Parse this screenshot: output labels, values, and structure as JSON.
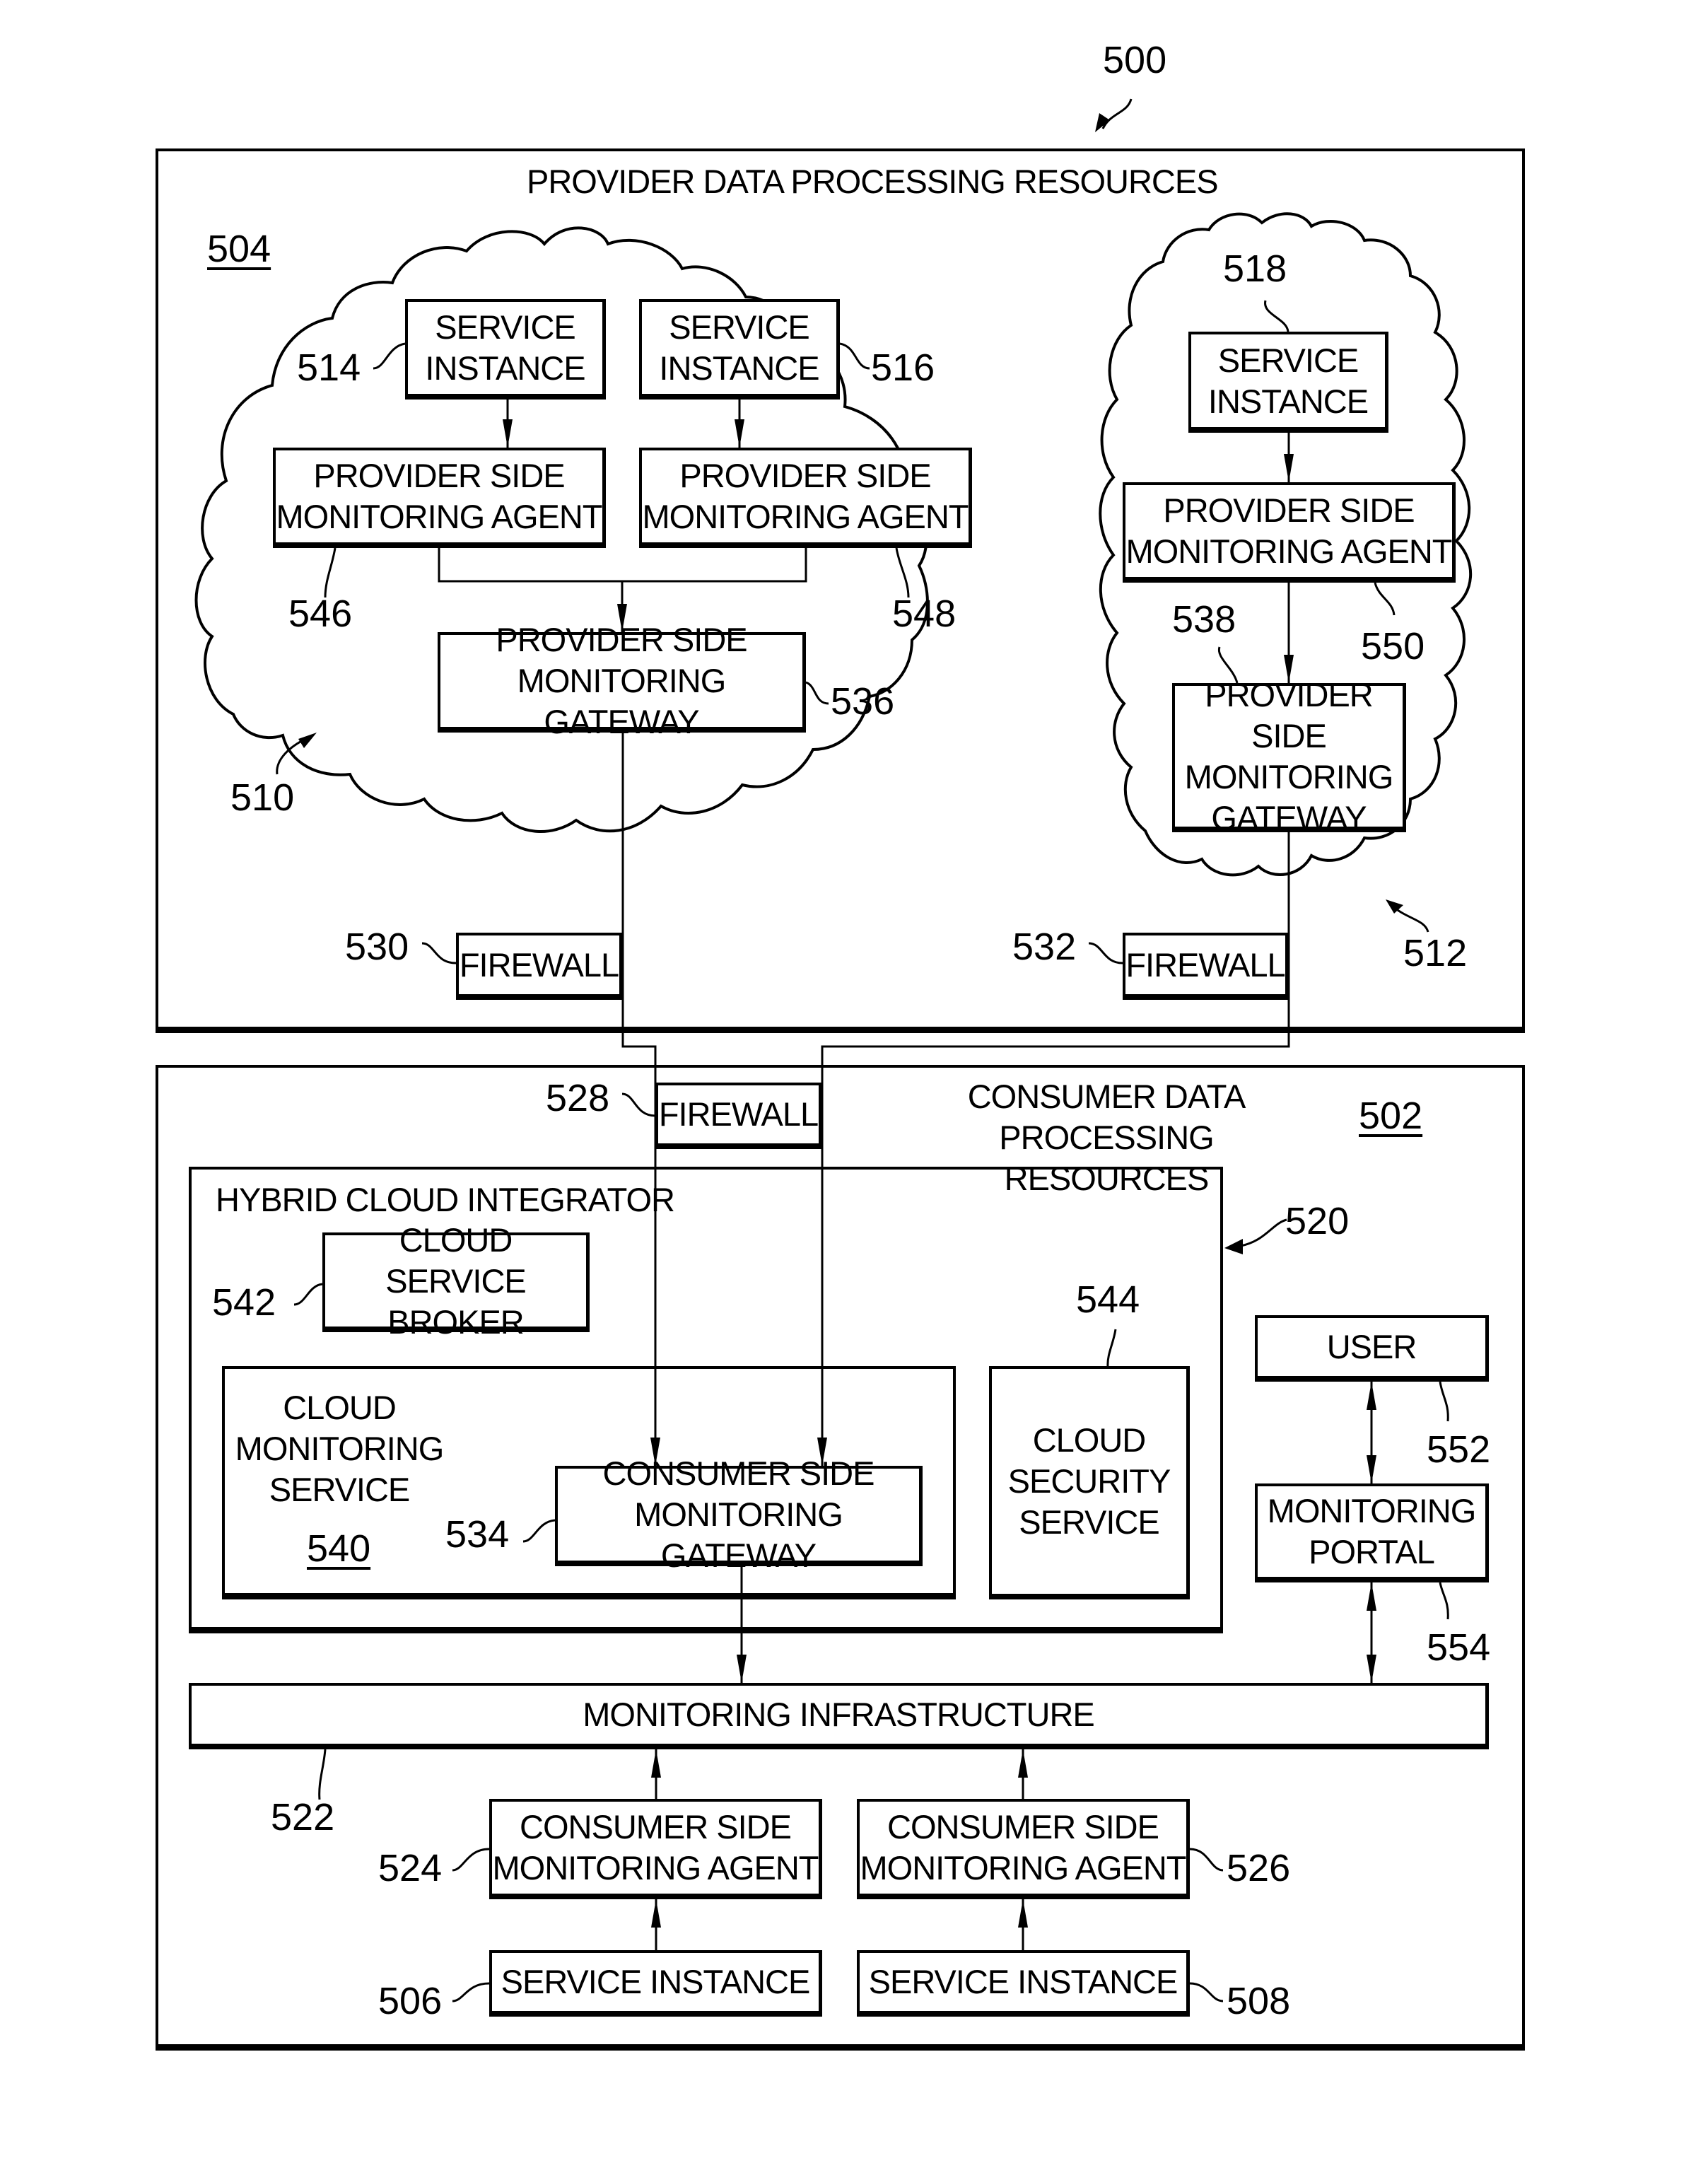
{
  "figure": {
    "ref": "500",
    "provider": {
      "title": "PROVIDER DATA PROCESSING RESOURCES",
      "ref": "504",
      "cloud_left": {
        "ref": "510",
        "service_instance_a": {
          "label": "SERVICE\nINSTANCE",
          "ref": "514"
        },
        "service_instance_b": {
          "label": "SERVICE\nINSTANCE",
          "ref": "516"
        },
        "agent_a": {
          "label": "PROVIDER SIDE\nMONITORING AGENT",
          "ref": "546"
        },
        "agent_b": {
          "label": "PROVIDER SIDE\nMONITORING AGENT",
          "ref": "548"
        },
        "gateway": {
          "label": "PROVIDER SIDE\nMONITORING GATEWAY",
          "ref": "536"
        }
      },
      "cloud_right": {
        "ref": "512",
        "service_instance": {
          "label": "SERVICE\nINSTANCE",
          "ref": "518"
        },
        "agent": {
          "label": "PROVIDER SIDE\nMONITORING AGENT",
          "ref": "550"
        },
        "gateway": {
          "label": "PROVIDER SIDE\nMONITORING\nGATEWAY",
          "ref": "538"
        }
      },
      "firewall_left": {
        "label": "FIREWALL",
        "ref": "530"
      },
      "firewall_right": {
        "label": "FIREWALL",
        "ref": "532"
      }
    },
    "consumer": {
      "title": "CONSUMER DATA\nPROCESSING RESOURCES",
      "ref": "502",
      "firewall": {
        "label": "FIREWALL",
        "ref": "528"
      },
      "hybrid_cloud_integrator": {
        "title": "HYBRID CLOUD INTEGRATOR",
        "ref": "520",
        "cloud_service_broker": {
          "label": "CLOUD SERVICE\nBROKER",
          "ref": "542"
        },
        "cloud_monitoring_service": {
          "label": "CLOUD\nMONITORING\nSERVICE",
          "ref": "540",
          "consumer_gateway": {
            "label": "CONSUMER SIDE\nMONITORING GATEWAY",
            "ref": "534"
          }
        },
        "cloud_security_service": {
          "label": "CLOUD\nSECURITY\nSERVICE",
          "ref": "544"
        }
      },
      "user": {
        "label": "USER",
        "ref": "552"
      },
      "monitoring_portal": {
        "label": "MONITORING\nPORTAL",
        "ref": "554"
      },
      "monitoring_infrastructure": {
        "label": "MONITORING INFRASTRUCTURE",
        "ref": "522"
      },
      "consumer_agent_a": {
        "label": "CONSUMER SIDE\nMONITORING AGENT",
        "ref": "524"
      },
      "consumer_agent_b": {
        "label": "CONSUMER SIDE\nMONITORING AGENT",
        "ref": "526"
      },
      "service_instance_a": {
        "label": "SERVICE INSTANCE",
        "ref": "506"
      },
      "service_instance_b": {
        "label": "SERVICE INSTANCE",
        "ref": "508"
      }
    }
  }
}
